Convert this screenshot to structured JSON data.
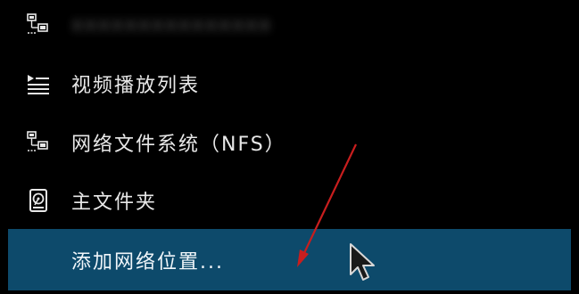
{
  "menu": {
    "items": [
      {
        "label": "xxxxxxxxxxxxxxx",
        "icon": "network-icon",
        "selected": false,
        "obscured": true
      },
      {
        "label": "视频播放列表",
        "icon": "playlist-icon",
        "selected": false
      },
      {
        "label": "网络文件系统（NFS）",
        "icon": "network-icon",
        "selected": false
      },
      {
        "label": "主文件夹",
        "icon": "hard-drive-icon",
        "selected": false
      },
      {
        "label": "添加网络位置...",
        "icon": "",
        "selected": true
      }
    ]
  },
  "colors": {
    "background": "#000000",
    "selected_row": "#0d4a6b",
    "text": "#e8e8e8",
    "annotation_arrow": "#c81e1e"
  }
}
